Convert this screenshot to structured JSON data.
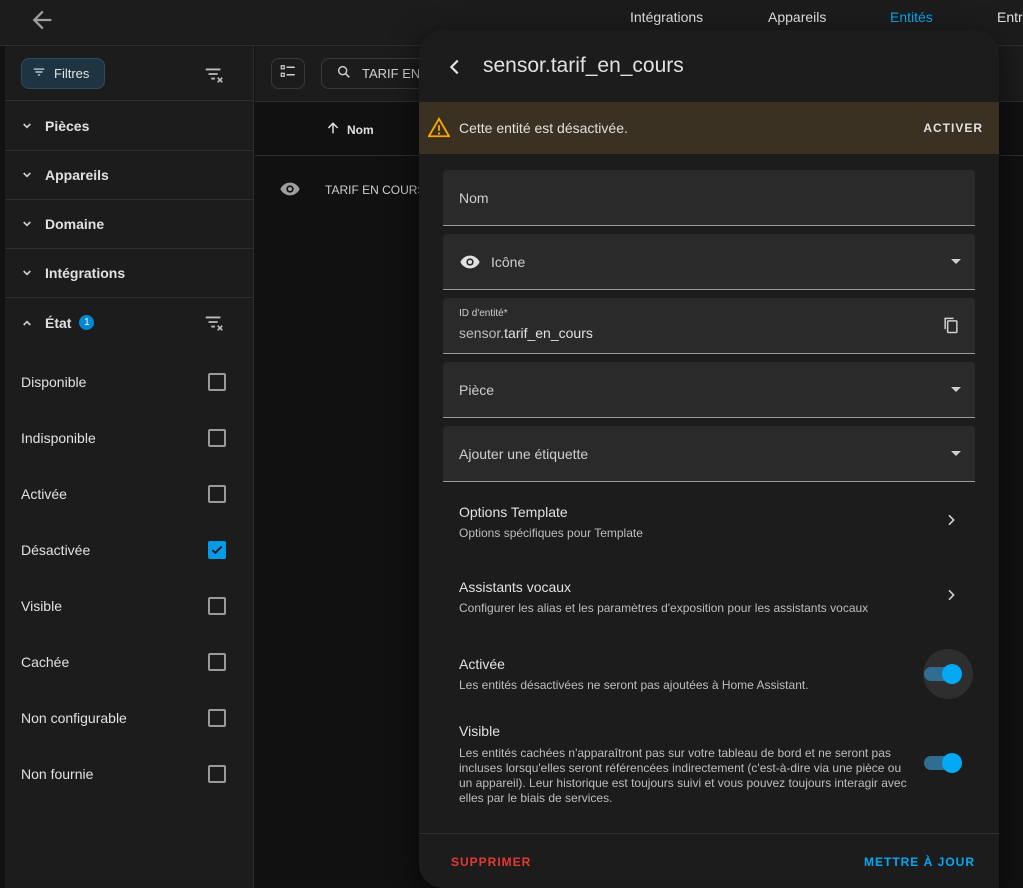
{
  "topbar": {
    "tabs": [
      {
        "label": "Intégrations"
      },
      {
        "label": "Appareils"
      },
      {
        "label": "Entités"
      },
      {
        "label": "Entr"
      }
    ],
    "active_tab": "Entités"
  },
  "filters": {
    "button_label": "Filtres",
    "sections": [
      {
        "label": "Pièces"
      },
      {
        "label": "Appareils"
      },
      {
        "label": "Domaine"
      },
      {
        "label": "Intégrations"
      },
      {
        "label": "État",
        "badge": "1"
      }
    ],
    "state_options": [
      {
        "label": "Disponible",
        "checked": false
      },
      {
        "label": "Indisponible",
        "checked": false
      },
      {
        "label": "Activée",
        "checked": false
      },
      {
        "label": "Désactivée",
        "checked": true
      },
      {
        "label": "Visible",
        "checked": false
      },
      {
        "label": "Cachée",
        "checked": false
      },
      {
        "label": "Non configurable",
        "checked": false
      },
      {
        "label": "Non fournie",
        "checked": false
      }
    ]
  },
  "table": {
    "search_text": "TARIF EN",
    "column_name": "Nom",
    "rows": [
      {
        "name": "TARIF EN COURS"
      }
    ]
  },
  "dialog": {
    "title": "sensor.tarif_en_cours",
    "warning": {
      "text": "Cette entité est désactivée.",
      "action": "ACTIVER"
    },
    "name_field": {
      "placeholder": "Nom"
    },
    "icon_field": {
      "value": "Icône"
    },
    "entity_id_field": {
      "label": "ID d'entité*",
      "prefix": "sensor.",
      "value": "tarif_en_cours"
    },
    "room_field": {
      "placeholder": "Pièce"
    },
    "label_field": {
      "placeholder": "Ajouter une étiquette"
    },
    "options_template": {
      "title": "Options Template",
      "subtitle": "Options spécifiques pour Template"
    },
    "voice_assistants": {
      "title": "Assistants vocaux",
      "subtitle": "Configurer les alias et les paramètres d'exposition pour les assistants vocaux"
    },
    "enabled": {
      "title": "Activée",
      "subtitle": "Les entités désactivées ne seront pas ajoutées à Home Assistant.",
      "on": true
    },
    "visible": {
      "title": "Visible",
      "subtitle": "Les entités cachées n'apparaîtront pas sur votre tableau de bord et ne seront pas incluses lorsqu'elles seront référencées indirectement (c'est-à-dire via une pièce ou un appareil). Leur historique est toujours suivi et vous pouvez toujours interagir avec elles par le biais de services.",
      "on": true
    },
    "delete_label": "SUPPRIMER",
    "update_label": "METTRE À JOUR"
  },
  "colors": {
    "accent": "#03a9f4",
    "danger": "#e53935",
    "warning": "#ffa600"
  }
}
